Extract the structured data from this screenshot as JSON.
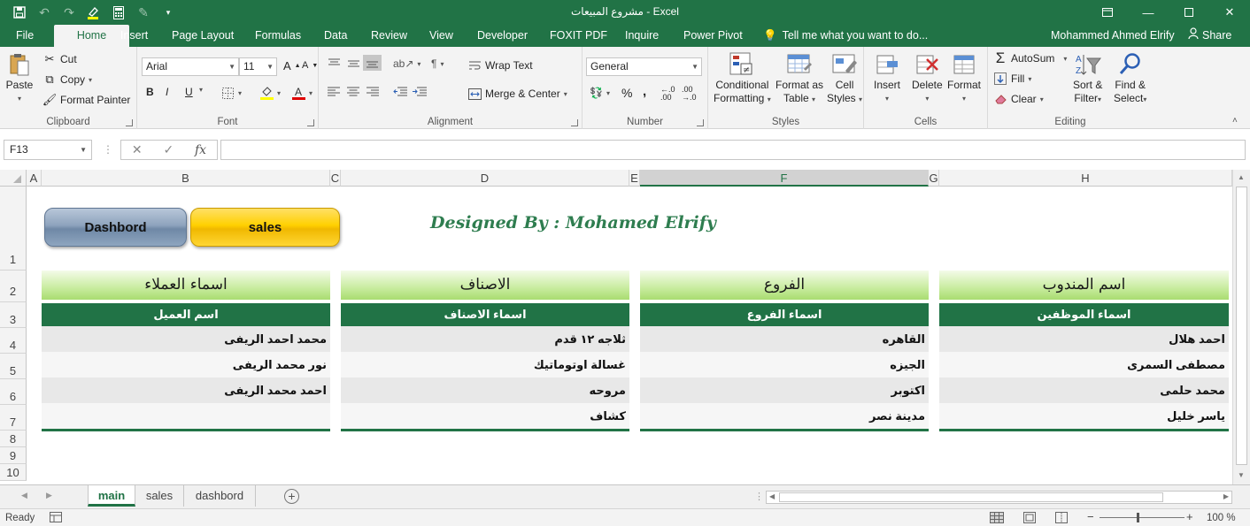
{
  "window": {
    "title": "مشروع المبيعات - Excel"
  },
  "ribbon_tabs": [
    "File",
    "Home",
    "Insert",
    "Page Layout",
    "Formulas",
    "Data",
    "Review",
    "View",
    "Developer",
    "FOXIT PDF",
    "Inquire",
    "Power Pivot"
  ],
  "active_tab": "Home",
  "tell_me": "Tell me what you want to do...",
  "user_name": "Mohammed Ahmed Elrify",
  "share_label": "Share",
  "clipboard": {
    "paste": "Paste",
    "cut": "Cut",
    "copy": "Copy",
    "format_painter": "Format Painter",
    "label": "Clipboard"
  },
  "font": {
    "name": "Arial",
    "size": "11",
    "label": "Font",
    "bold": "B",
    "italic": "I",
    "underline": "U"
  },
  "alignment": {
    "wrap_text": "Wrap Text",
    "merge_center": "Merge & Center",
    "label": "Alignment"
  },
  "number": {
    "format": "General",
    "percent": "%",
    "comma": ",",
    "label": "Number"
  },
  "styles": {
    "conditional_1": "Conditional",
    "conditional_2": "Formatting",
    "format_table_1": "Format as",
    "format_table_2": "Table",
    "cell_styles_1": "Cell",
    "cell_styles_2": "Styles",
    "label": "Styles"
  },
  "cells": {
    "insert": "Insert",
    "delete": "Delete",
    "format": "Format",
    "label": "Cells"
  },
  "editing": {
    "autosum": "AutoSum",
    "fill": "Fill",
    "clear": "Clear",
    "sort_1": "Sort &",
    "sort_2": "Filter",
    "find_1": "Find &",
    "find_2": "Select",
    "label": "Editing"
  },
  "formula_bar": {
    "name_box": "F13",
    "formula": ""
  },
  "columns": [
    "A",
    "B",
    "C",
    "D",
    "E",
    "F",
    "G",
    "H"
  ],
  "selected_column": "F",
  "rows": [
    "1",
    "2",
    "3",
    "4",
    "5",
    "6",
    "7",
    "8",
    "9",
    "10"
  ],
  "sheet": {
    "btn_dashboard": "Dashbord",
    "btn_sales": "sales",
    "designed_by": "Designed By : Mohamed Elrify",
    "tables": [
      {
        "title": "اسماء العملاء",
        "header": "اسم العميل",
        "items": [
          "محمد احمد الريفى",
          "نور محمد الريفى",
          "احمد محمد الريفى",
          ""
        ]
      },
      {
        "title": "الاصناف",
        "header": "اسماء الاصناف",
        "items": [
          "ثلاجه ١٢ قدم",
          "غسالة اوتوماتيك",
          "مروحه",
          "كشاف"
        ]
      },
      {
        "title": "الفروع",
        "header": "اسماء الفروع",
        "items": [
          "القاهره",
          "الجيزه",
          "اكتوبر",
          "مدينة نصر"
        ]
      },
      {
        "title": "اسم المندوب",
        "header": "اسماء الموظفين",
        "items": [
          "احمد هلال",
          "مصطفى السمرى",
          "محمد حلمى",
          "ياسر خليل"
        ]
      }
    ]
  },
  "sheet_tabs": [
    "main",
    "sales",
    "dashbord"
  ],
  "active_sheet": "main",
  "status": {
    "ready": "Ready",
    "zoom": "100 %"
  }
}
